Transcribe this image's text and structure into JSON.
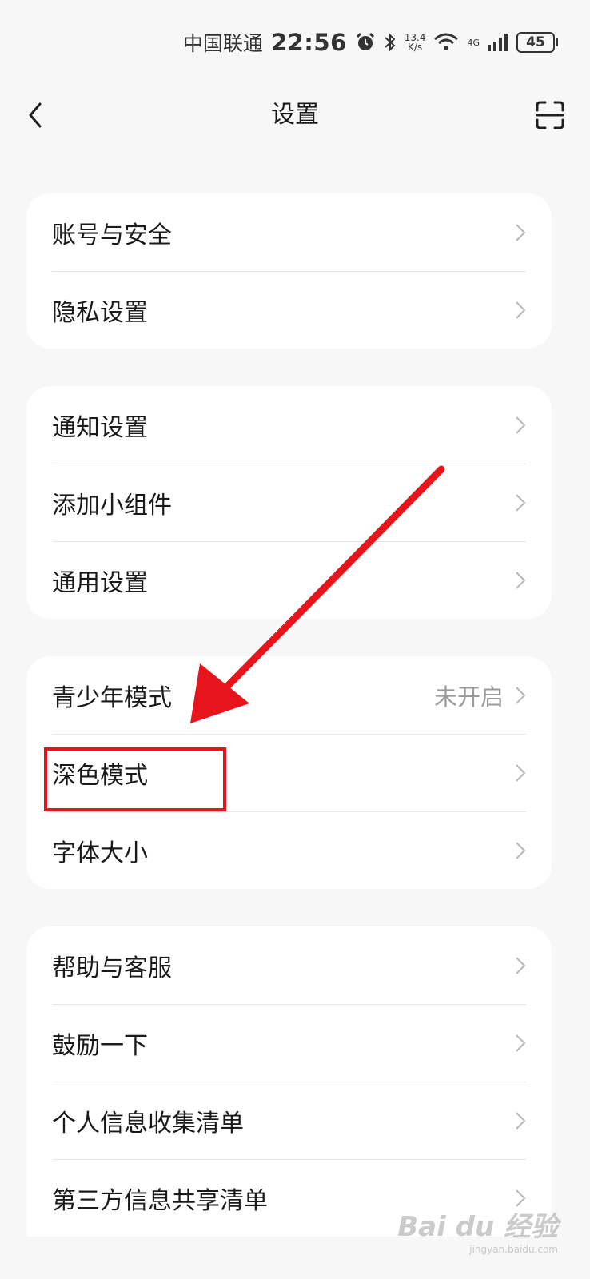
{
  "status_bar": {
    "carrier": "中国联通",
    "time": "22:56",
    "speed_value": "13.4",
    "speed_unit": "K/s",
    "network": "4G",
    "battery": "45"
  },
  "header": {
    "title": "设置"
  },
  "groups": [
    {
      "items": [
        {
          "label": "账号与安全"
        },
        {
          "label": "隐私设置"
        }
      ]
    },
    {
      "items": [
        {
          "label": "通知设置"
        },
        {
          "label": "添加小组件"
        },
        {
          "label": "通用设置"
        }
      ]
    },
    {
      "items": [
        {
          "label": "青少年模式",
          "value": "未开启"
        },
        {
          "label": "深色模式"
        },
        {
          "label": "字体大小"
        }
      ]
    },
    {
      "items": [
        {
          "label": "帮助与客服"
        },
        {
          "label": "鼓励一下"
        },
        {
          "label": "个人信息收集清单"
        },
        {
          "label": "第三方信息共享清单"
        }
      ]
    }
  ],
  "annotation": {
    "color": "#e8141b"
  },
  "watermark": {
    "text": "Bai du 经验",
    "sub": "jingyan.baidu.com"
  }
}
